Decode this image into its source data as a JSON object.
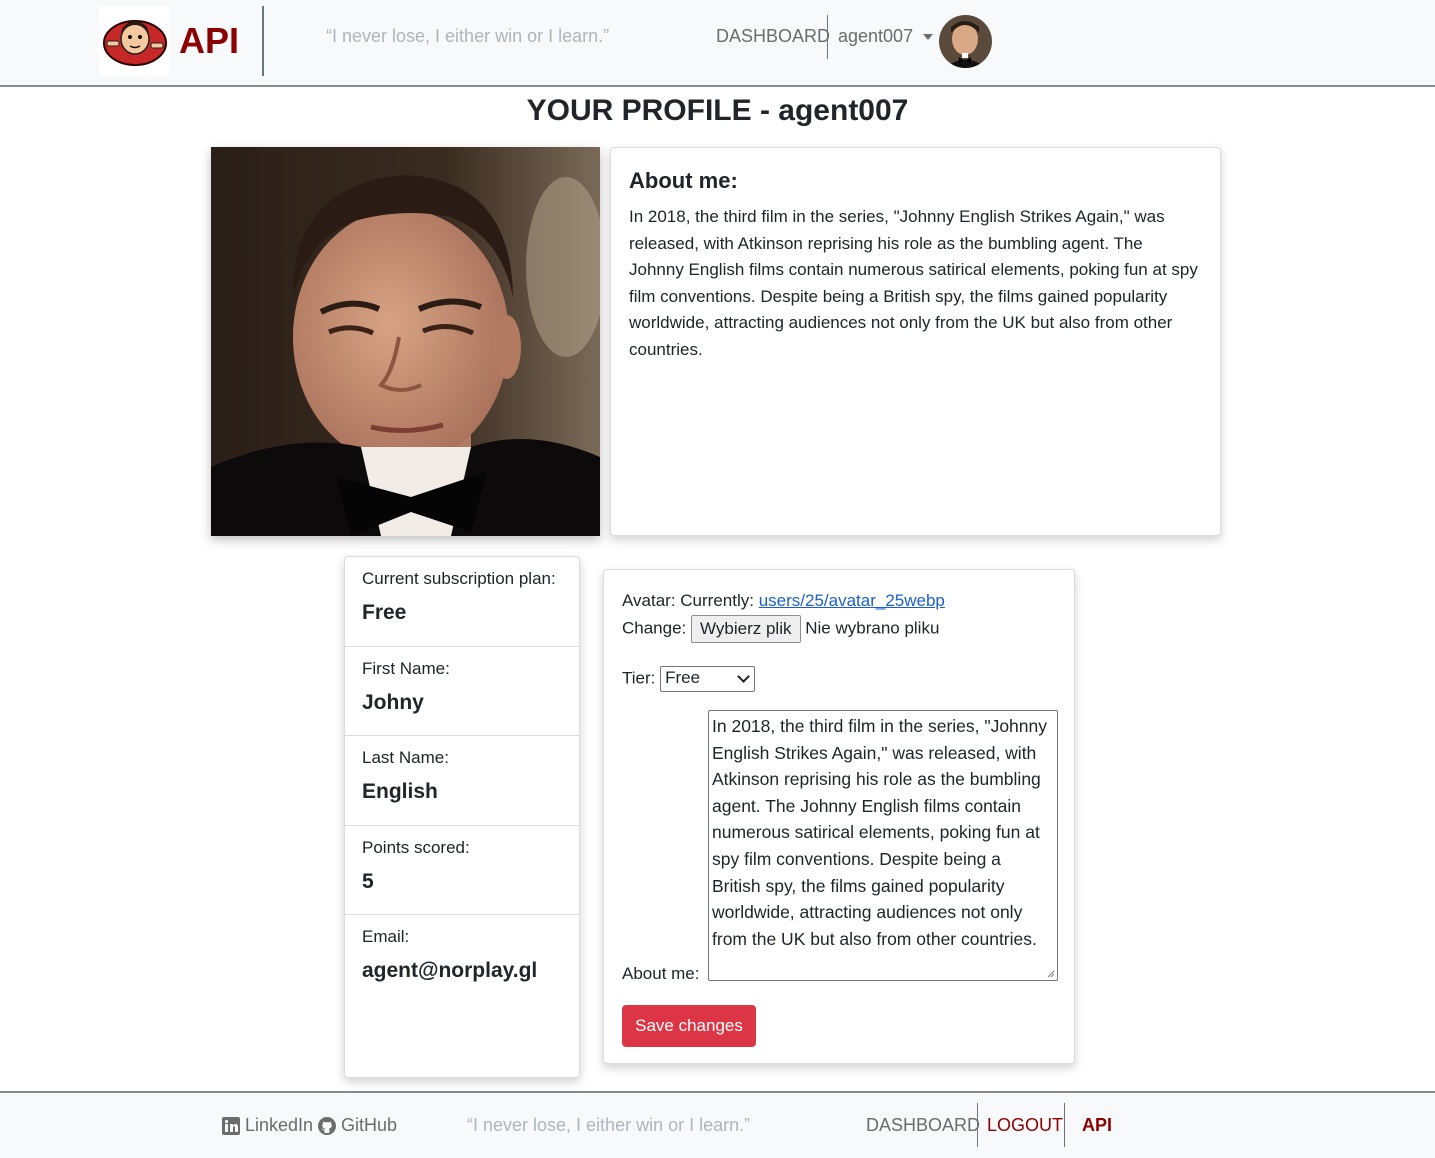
{
  "header": {
    "brand": "API",
    "quote": "“I never lose, I either win or I learn.”",
    "nav_dashboard": "DASHBOARD",
    "username": "agent007"
  },
  "page": {
    "title": "YOUR PROFILE - agent007"
  },
  "about": {
    "title": "About me:",
    "text": "In 2018, the third film in the series, \"Johnny English Strikes Again,\" was released, with Atkinson reprising his role as the bumbling agent. The Johnny English films contain numerous satirical elements, poking fun at spy film conventions. Despite being a British spy, the films gained popularity worldwide, attracting audiences not only from the UK but also from other countries."
  },
  "info": [
    {
      "label": "Current subscription plan:",
      "value": "Free"
    },
    {
      "label": "First Name:",
      "value": "Johny"
    },
    {
      "label": "Last Name:",
      "value": "English"
    },
    {
      "label": "Points scored:",
      "value": "5"
    },
    {
      "label": "Email:",
      "value": "agent@norplay.gl"
    }
  ],
  "form": {
    "avatar_label": "Avatar: Currently:",
    "avatar_link": "users/25/avatar_25webp",
    "change_label": "Change:",
    "file_button": "Wybierz plik",
    "file_status": "Nie wybrano pliku",
    "tier_label": "Tier:",
    "tier_value": "Free",
    "about_label": "About me:",
    "about_value": "In 2018, the third film in the series, \"Johnny English Strikes Again,\" was released, with Atkinson reprising his role as the bumbling agent. The Johnny English films contain numerous satirical elements, poking fun at spy film conventions. Despite being a British spy, the films gained popularity worldwide, attracting audiences not only from the UK but also from other countries.",
    "save_button": "Save changes"
  },
  "footer": {
    "linkedin": "LinkedIn",
    "github": "GitHub",
    "quote": "“I never lose, I either win or I learn.”",
    "dashboard": "DASHBOARD",
    "logout": "LOGOUT",
    "api": "API"
  },
  "colors": {
    "brand": "#8b0000",
    "danger": "#dc3545",
    "link": "#1a5fd0",
    "navbar_bg": "#f8f9fa"
  },
  "icons": [
    "mr-bean-logo-icon",
    "caret-down-icon",
    "linkedin-icon",
    "github-icon",
    "resize-handle-icon"
  ]
}
